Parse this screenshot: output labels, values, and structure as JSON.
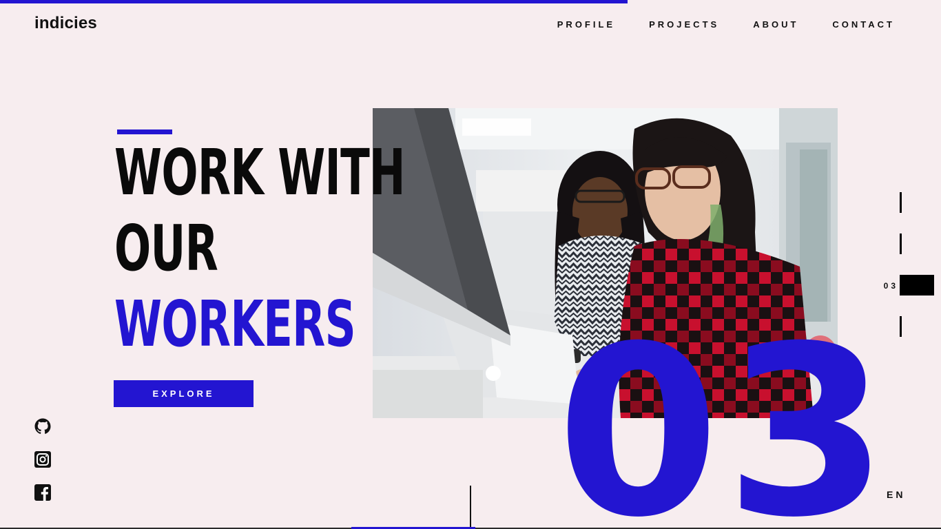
{
  "brand": {
    "logo": "indicies"
  },
  "nav": {
    "items": [
      {
        "label": "PROFILE"
      },
      {
        "label": "PROJECTS"
      },
      {
        "label": "ABOUT"
      },
      {
        "label": "CONTACT"
      }
    ]
  },
  "hero": {
    "headline": [
      "WORK WITH",
      "OUR",
      "WORKERS"
    ],
    "cta_label": "EXPLORE",
    "slide_number": "03",
    "image_icon": "two-women-working-at-computers-photo"
  },
  "pager": {
    "current_label": "03"
  },
  "language": "EN",
  "social": [
    {
      "icon": "github-icon"
    },
    {
      "icon": "instagram-icon"
    },
    {
      "icon": "facebook-icon"
    }
  ],
  "colors": {
    "accent": "#2315d1",
    "background": "#f7edef",
    "text": "#111111"
  }
}
